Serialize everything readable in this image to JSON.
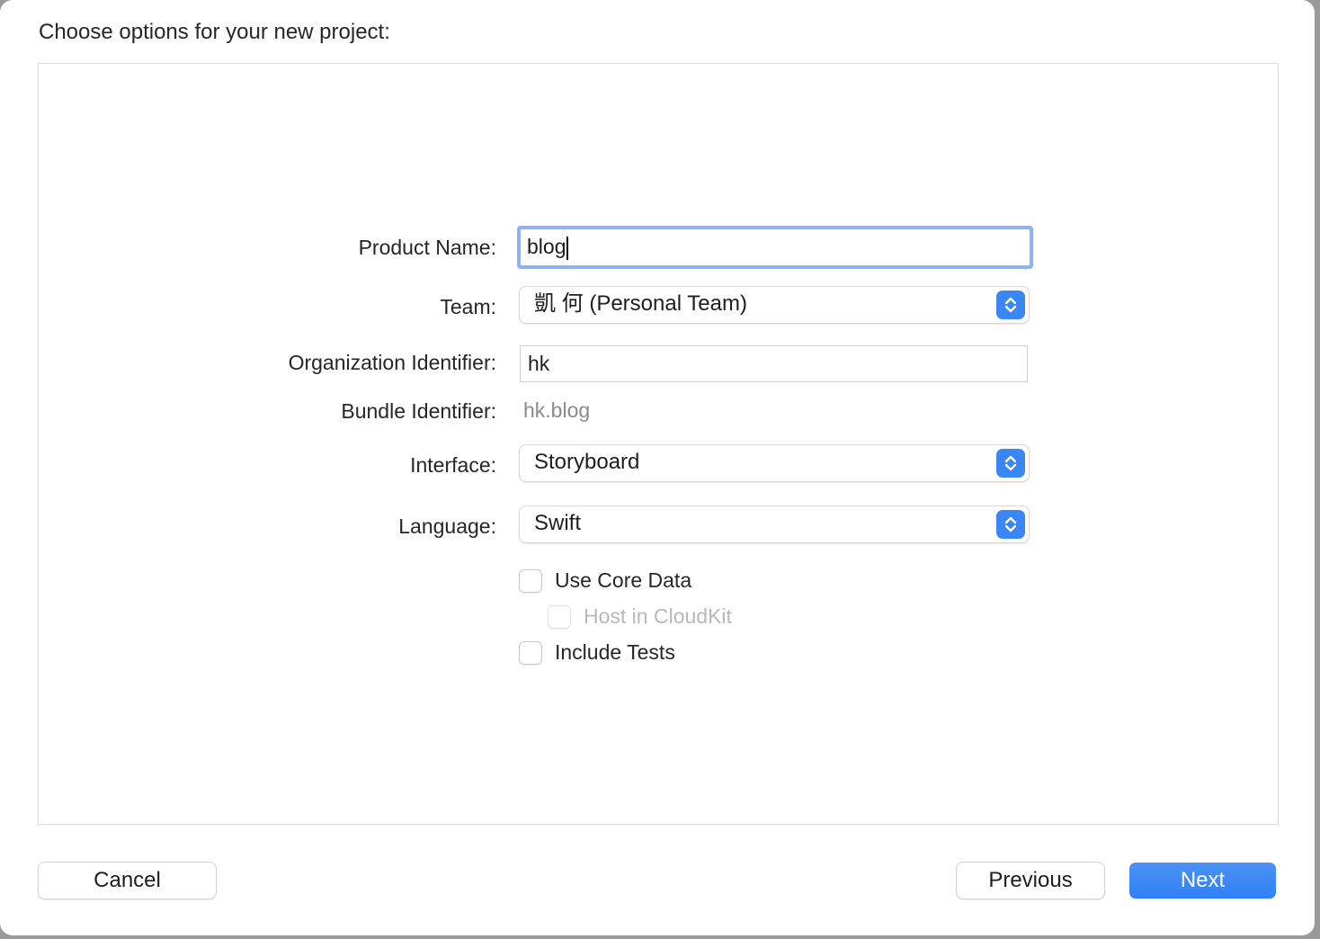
{
  "dialog": {
    "title": "Choose options for your new project:"
  },
  "form": {
    "product_name": {
      "label": "Product Name:",
      "value": "blog"
    },
    "team": {
      "label": "Team:",
      "value": "凱 何 (Personal Team)"
    },
    "organization_identifier": {
      "label": "Organization Identifier:",
      "value": "hk"
    },
    "bundle_identifier": {
      "label": "Bundle Identifier:",
      "value": "hk.blog"
    },
    "interface": {
      "label": "Interface:",
      "value": "Storyboard"
    },
    "language": {
      "label": "Language:",
      "value": "Swift"
    },
    "use_core_data": {
      "label": "Use Core Data",
      "checked": false
    },
    "host_in_cloudkit": {
      "label": "Host in CloudKit",
      "checked": false,
      "enabled": false
    },
    "include_tests": {
      "label": "Include Tests",
      "checked": false
    }
  },
  "buttons": {
    "cancel": "Cancel",
    "previous": "Previous",
    "next": "Next"
  },
  "colors": {
    "accent": "#3a86f5",
    "focus_ring": "#8fb0f3"
  }
}
